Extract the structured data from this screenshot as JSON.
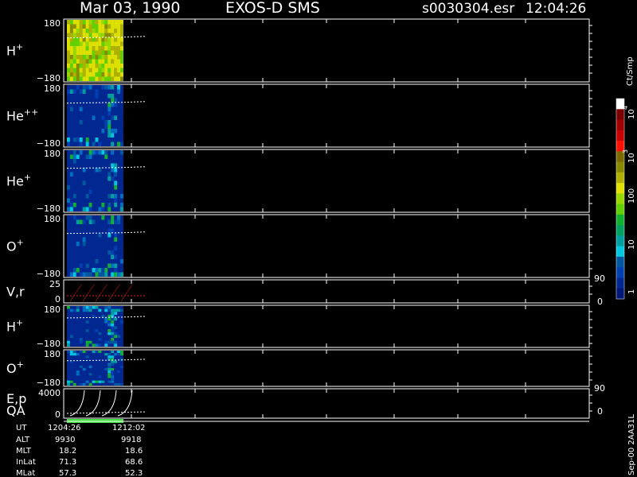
{
  "header": {
    "date": "Mar 03, 1990",
    "instrument": "EXOS-D SMS",
    "file": "s0030304.esr",
    "time": "12:04:26"
  },
  "colorbar": {
    "unit_label": "Ct/Smp",
    "tick_labels": [
      "10",
      "4",
      "10",
      "3",
      "100",
      "10",
      "1"
    ],
    "colors": [
      "#ffffff",
      "#7a0000",
      "#a00000",
      "#c80000",
      "#ff1000",
      "#7a6a00",
      "#8a8a00",
      "#b0b000",
      "#e0e000",
      "#98d800",
      "#60d000",
      "#10b030",
      "#00a060",
      "#00a0a0",
      "#00c8e0",
      "#0058a0",
      "#0040b0",
      "#002890",
      "#001878"
    ]
  },
  "right_axis": {
    "vr_top": "90",
    "vr_bottom": "0",
    "ep_top": "90",
    "ep_bottom": "0"
  },
  "footer": {
    "rows": [
      {
        "label": "UT",
        "v1": "1204:26",
        "v2": "1212:02"
      },
      {
        "label": "ALT",
        "v1": "9930",
        "v2": "9918"
      },
      {
        "label": "MLT",
        "v1": "18.2",
        "v2": "18.6"
      },
      {
        "label": "InLat",
        "v1": "71.3",
        "v2": "68.6"
      },
      {
        "label": "MLat",
        "v1": "57.3",
        "v2": "52.3"
      }
    ],
    "version": "Sep-00 2AA31L"
  },
  "palette": {
    "background": "#000000",
    "axis": "#ffffff",
    "velocity": "#e02020",
    "quality": "#40e040"
  },
  "chart_data": {
    "type": "heatmap",
    "x_range_ut": [
      "1204:26",
      "1212:02"
    ],
    "panels": [
      {
        "name": "H",
        "sup": "+",
        "ylim": [
          -180,
          180
        ],
        "tick_top": "180",
        "tick_bottom": "−180",
        "dominant_level": "100-1000 Ct/Smp"
      },
      {
        "name": "He",
        "sup": "++",
        "ylim": [
          -180,
          180
        ],
        "tick_top": "180",
        "tick_bottom": "−180",
        "dominant_level": "1 Ct/Smp"
      },
      {
        "name": "He",
        "sup": "+",
        "ylim": [
          -180,
          180
        ],
        "tick_top": "180",
        "tick_bottom": "−180",
        "dominant_level": "1-10 Ct/Smp"
      },
      {
        "name": "O",
        "sup": "+",
        "ylim": [
          -180,
          180
        ],
        "tick_top": "180",
        "tick_bottom": "−180",
        "dominant_level": "1-10 Ct/Smp"
      },
      {
        "name": "V,r",
        "sup": "",
        "ylim": [
          0,
          25
        ],
        "tick_top": "25",
        "tick_bottom": "0",
        "kind": "line"
      },
      {
        "name": "H",
        "sup": "+",
        "ylim": [
          -180,
          180
        ],
        "tick_top": "180",
        "tick_bottom": "−180",
        "dominant_level": "1-10 Ct/Smp"
      },
      {
        "name": "O",
        "sup": "+",
        "ylim": [
          -180,
          180
        ],
        "tick_top": "180",
        "tick_bottom": "−180",
        "dominant_level": "1 Ct/Smp"
      },
      {
        "name": "E,p",
        "name2": "QA",
        "sup": "",
        "ylim": [
          0,
          4000
        ],
        "tick_top": "4000",
        "tick_bottom": "0",
        "kind": "line"
      }
    ],
    "colorbar_range": [
      1,
      10000
    ],
    "grid": true,
    "legend": "right"
  }
}
